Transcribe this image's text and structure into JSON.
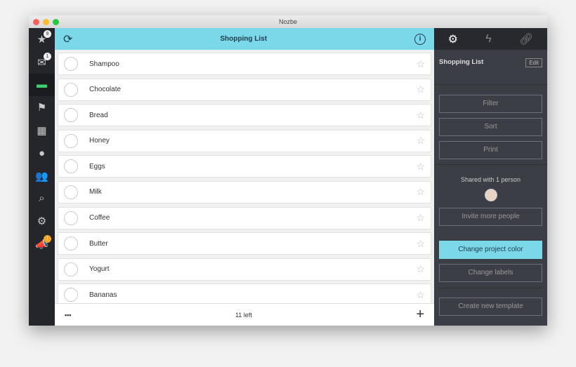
{
  "window": {
    "title": "Nozbe"
  },
  "sidebar": {
    "items": [
      {
        "name": "priority",
        "icon": "★",
        "badge": "9"
      },
      {
        "name": "inbox",
        "icon": "✉",
        "badge": "1"
      },
      {
        "name": "projects",
        "icon": "▬",
        "active": true
      },
      {
        "name": "categories",
        "icon": "⚑"
      },
      {
        "name": "calendar",
        "icon": "▦"
      },
      {
        "name": "comments",
        "icon": "●"
      },
      {
        "name": "team",
        "icon": "👥"
      },
      {
        "name": "search",
        "icon": "⌕"
      },
      {
        "name": "settings",
        "icon": "⚙"
      },
      {
        "name": "feedback",
        "icon": "📣",
        "badge": "!"
      }
    ]
  },
  "header": {
    "title": "Shopping List"
  },
  "tasks": [
    "Shampoo",
    "Chocolate",
    "Bread",
    "Honey",
    "Eggs",
    "Milk",
    "Coffee",
    "Butter",
    "Yogurt",
    "Bananas"
  ],
  "footer": {
    "more": "•••",
    "count": "11 left",
    "add": "+"
  },
  "panel": {
    "title": "Shopping List",
    "edit": "Edit",
    "filter": "Filter",
    "sort": "Sort",
    "print": "Print",
    "shared": "Shared with 1 person",
    "invite": "Invite more people",
    "color": "Change project color",
    "labels": "Change labels",
    "template": "Create new template"
  },
  "colors": {
    "accent": "#7ad8e8",
    "sidebar": "#24262b",
    "panel": "#3b3e45",
    "active": "#3ccf6e"
  }
}
